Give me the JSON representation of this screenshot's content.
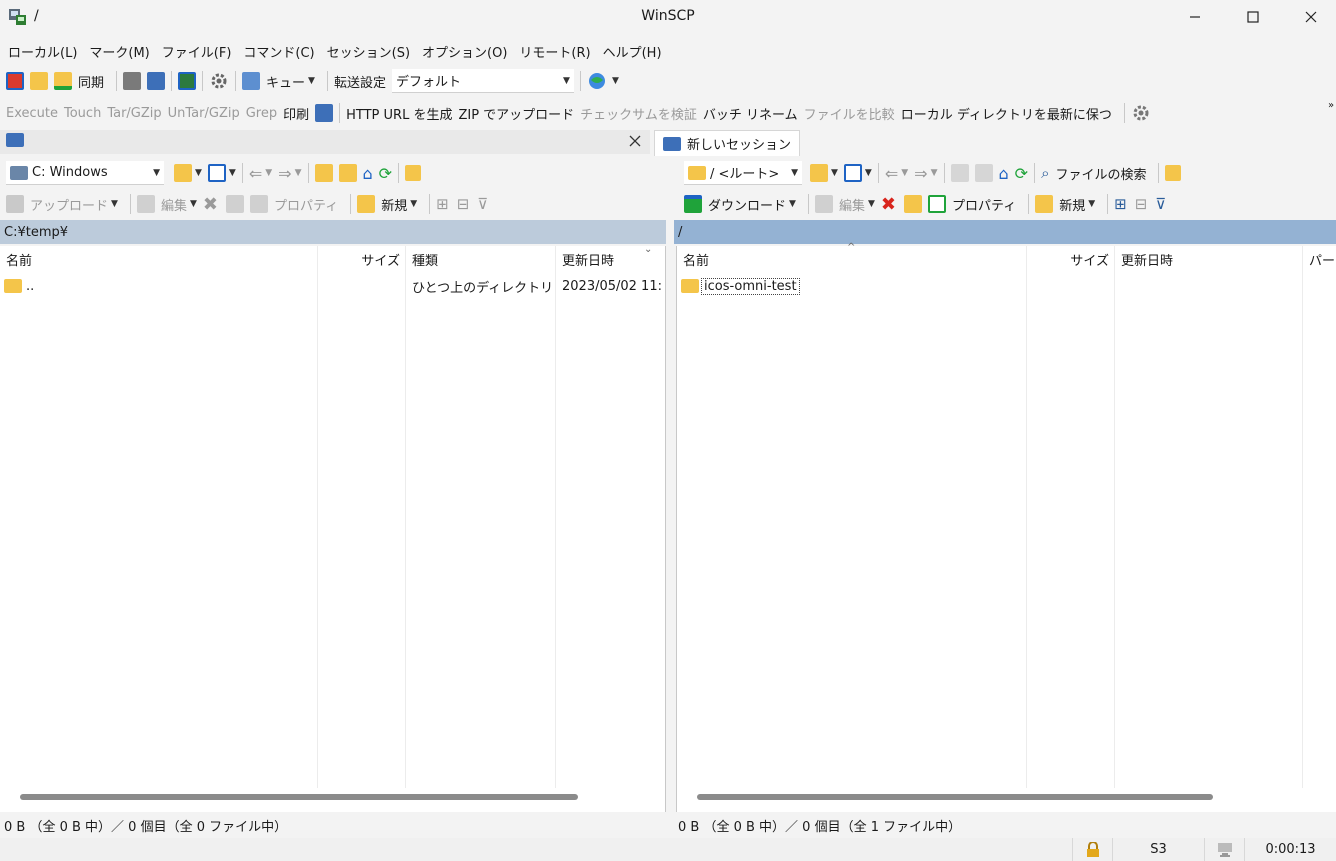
{
  "window": {
    "path": "/",
    "title": "WinSCP"
  },
  "menu": [
    "ローカル(L)",
    "マーク(M)",
    "ファイル(F)",
    "コマンド(C)",
    "セッション(S)",
    "オプション(O)",
    "リモート(R)",
    "ヘルプ(H)"
  ],
  "toolbar1": {
    "sync_label": "同期",
    "queue_label": "キュー",
    "transfer_label": "転送設定",
    "transfer_value": "デフォルト"
  },
  "toolbar2": {
    "items": [
      "Execute",
      "Touch",
      "Tar/GZip",
      "UnTar/GZip",
      "Grep",
      "印刷"
    ],
    "items2": [
      "HTTP URL を生成",
      "ZIP でアップロード",
      "チェックサムを検証",
      "バッチ リネーム",
      "ファイルを比較",
      "ローカル ディレクトリを最新に保つ"
    ]
  },
  "session": {
    "new_session_label": "新しいセッション"
  },
  "local": {
    "drive": "C: Windows",
    "upload_label": "アップロード",
    "edit_label": "編集",
    "properties_label": "プロパティ",
    "new_label": "新規",
    "path": "C:¥temp¥",
    "columns": [
      "名前",
      "サイズ",
      "種類",
      "更新日時"
    ],
    "rows": [
      {
        "name": "..",
        "size": "",
        "type": "ひとつ上のディレクトリ",
        "modified": "2023/05/02  11:"
      }
    ],
    "status": "0 B （全 0 B 中）／ 0 個目（全 0 ファイル中）"
  },
  "remote": {
    "location": "/ <ルート>",
    "find_label": "ファイルの検索",
    "download_label": "ダウンロード",
    "edit_label": "編集",
    "properties_label": "プロパティ",
    "new_label": "新規",
    "path": "/",
    "columns": [
      "名前",
      "サイズ",
      "更新日時",
      "パーミ"
    ],
    "rows": [
      {
        "name": "icos-omni-test"
      }
    ],
    "status": "0 B （全 0 B 中）／ 0 個目（全 1 ファイル中）"
  },
  "bottom": {
    "protocol": "S3",
    "elapsed": "0:00:13"
  },
  "colors": {
    "accent_blue": "#1e63c4",
    "green": "#1fa33a",
    "folder": "#f4c54a",
    "local_header": "#bccbdb",
    "remote_header": "#94b2d3"
  }
}
